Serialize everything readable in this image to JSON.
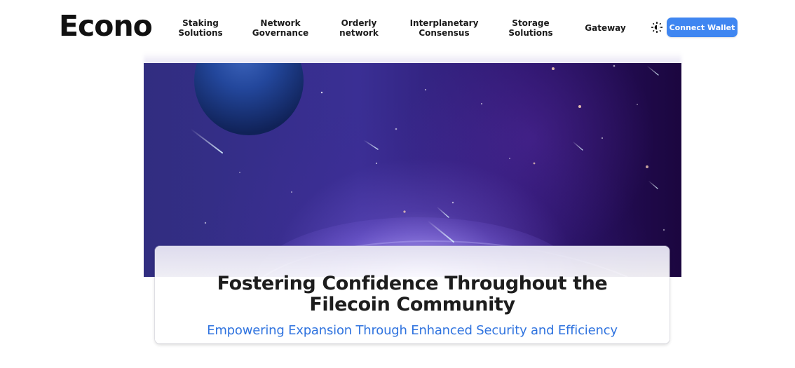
{
  "colors": {
    "background": "#ffffff",
    "text_primary": "#1d1d1d",
    "accent": "#3f86f1",
    "subtitle": "#2f73df",
    "hero_dark": "#1b063f",
    "hero_mid": "#3a2f94",
    "hero_glow": "#b5a1ff"
  },
  "header": {
    "logo": "Econo",
    "nav": [
      {
        "label": "Staking\nSolutions"
      },
      {
        "label": "Network\nGovernance"
      },
      {
        "label": "Orderly\nnetwork"
      },
      {
        "label": "Interplanetary\nConsensus"
      },
      {
        "label": "Storage\nSolutions"
      },
      {
        "label": "Gateway"
      }
    ],
    "theme_toggle_icon": "theme-toggle-icon",
    "connect_wallet": "Connect Wallet"
  },
  "hero": {
    "image": "space-scene",
    "title": "Fostering Confidence Throughout the\nFilecoin Community",
    "subtitle": "Empowering Expansion Through Enhanced Security and Efficiency"
  }
}
